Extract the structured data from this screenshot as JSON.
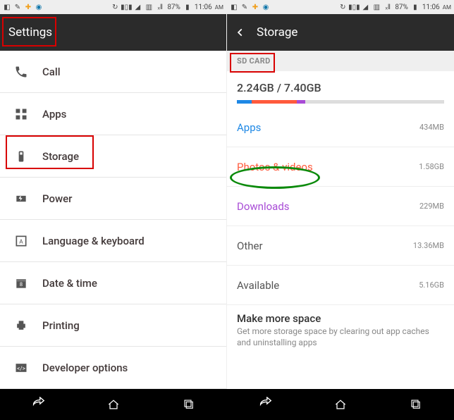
{
  "statusbar": {
    "battery_pct": "87%",
    "time": "11:06",
    "time_suffix": "AM"
  },
  "left": {
    "title": "Settings",
    "items": [
      {
        "label": "Call"
      },
      {
        "label": "Apps"
      },
      {
        "label": "Storage"
      },
      {
        "label": "Power"
      },
      {
        "label": "Language & keyboard"
      },
      {
        "label": "Date & time"
      },
      {
        "label": "Printing"
      },
      {
        "label": "Developer options"
      }
    ]
  },
  "right": {
    "title": "Storage",
    "section": "SD CARD",
    "usage": "2.24GB / 7.40GB",
    "bar": [
      {
        "color": "#1e88e5",
        "width_pct": 7
      },
      {
        "color": "#ff5a3c",
        "width_pct": 22
      },
      {
        "color": "#a84bd6",
        "width_pct": 4
      }
    ],
    "rows": [
      {
        "name": "Apps",
        "color": "#1e88e5",
        "size": "434MB"
      },
      {
        "name": "Photos & videos",
        "color": "#ff5a3c",
        "size": "1.58GB"
      },
      {
        "name": "Downloads",
        "color": "#a84bd6",
        "size": "229MB"
      },
      {
        "name": "Other",
        "color": "#555",
        "size": "13.36MB"
      },
      {
        "name": "Available",
        "color": "#555",
        "size": "5.16GB"
      }
    ],
    "make_more": {
      "title": "Make more space",
      "sub": "Get more storage space by clearing out app caches and uninstalling apps"
    }
  }
}
